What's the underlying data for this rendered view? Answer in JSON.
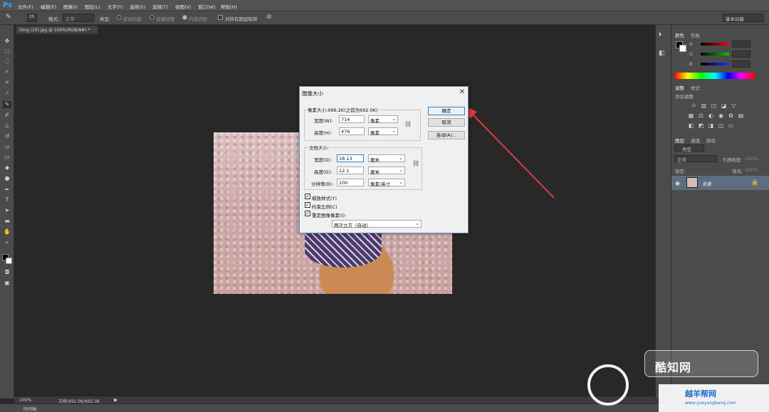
{
  "app": {
    "logo": "Ps"
  },
  "menu": [
    "文件(F)",
    "编辑(E)",
    "图像(I)",
    "图层(L)",
    "文字(Y)",
    "选择(S)",
    "滤镜(T)",
    "视图(V)",
    "窗口(W)",
    "帮助(H)"
  ],
  "options": {
    "size_value": "25",
    "mode_label": "模式:",
    "mode_value": "正常",
    "type_label": "类型:",
    "radio1": "近似匹配",
    "radio2": "创建纹理",
    "radio3": "内容识别",
    "sample_all": "对所有图层取样",
    "workspace": "基本功能"
  },
  "document": {
    "tab_title": "timg (10).jpg @ 100%(RGB/8#) *"
  },
  "status": {
    "zoom": "100%",
    "doc_info": "文档:692.0K/692.0K",
    "timeline": "时间轴"
  },
  "panels": {
    "color_tabs": [
      "颜色",
      "色板"
    ],
    "rgb_labels": [
      "R",
      "G",
      "B"
    ],
    "adjust_tabs": [
      "调整",
      "样式"
    ],
    "adjust_hint": "添加调整",
    "layer_tabs": [
      "图层",
      "通道",
      "路径"
    ],
    "layer_kind": "类型",
    "blend_mode": "正常",
    "opacity_label": "不透明度:",
    "opacity_value": "100%",
    "lock_label": "锁定:",
    "fill_label": "填充:",
    "fill_value": "100%",
    "layer_name": "背景"
  },
  "dialog": {
    "title": "图像大小",
    "pixel_group": "像素大小:996.2K(之前为692.0K)",
    "width_label": "宽度(W):",
    "width_px": "714",
    "width_px_unit": "像素",
    "height_label": "高度(H):",
    "height_px": "476",
    "height_px_unit": "像素",
    "doc_group": "文档大小:",
    "doc_width_label": "宽度(D):",
    "doc_width": "18.13",
    "doc_width_unit": "厘米",
    "doc_height_label": "高度(G):",
    "doc_height": "12.1",
    "doc_height_unit": "厘米",
    "res_label": "分辨率(R):",
    "res_value": "100",
    "res_unit": "像素/英寸",
    "ok": "确定",
    "cancel": "取消",
    "auto": "自动(A)...",
    "scale_styles": "缩放样式(Y)",
    "constrain": "约束比例(C)",
    "resample": "重定图像像素(I):",
    "resample_method": "两次立方（自动）"
  },
  "watermark": {
    "text1": "酷知网",
    "text2": "越羊帮网",
    "url": "www.yueyangbang.com"
  },
  "colors": {
    "arrow": "#e03a3a",
    "accent": "#31a8ff"
  }
}
